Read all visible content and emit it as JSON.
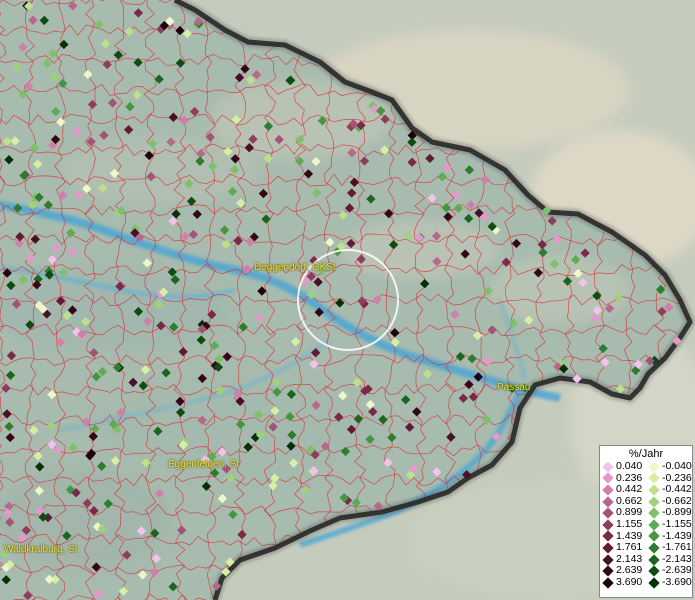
{
  "places": [
    {
      "id": "deggendorf",
      "label": "Deggendorf, GKSt"
    },
    {
      "id": "passau",
      "label": "Passau"
    },
    {
      "id": "eggenfelden",
      "label": "Eggenfelden, St"
    },
    {
      "id": "waldkraiburg",
      "label": "Waldkraiburg, St"
    }
  ],
  "legend": {
    "title": "%/Jahr",
    "positive": [
      "0.040",
      "0.236",
      "0.442",
      "0.662",
      "0.899",
      "1.155",
      "1.439",
      "1.761",
      "2.143",
      "2.639",
      "3.690"
    ],
    "negative": [
      "-0.040",
      "-0.236",
      "-0.442",
      "-0.662",
      "-0.899",
      "-1.155",
      "-1.439",
      "-1.761",
      "-2.143",
      "-2.639",
      "-3.690"
    ],
    "positive_colors": [
      "#f4c3ec",
      "#e39acb",
      "#cf7fa9",
      "#b8688d",
      "#a55276",
      "#8f3d5d",
      "#7a2a48",
      "#621a35",
      "#4a0e25",
      "#330716",
      "#1d020b"
    ],
    "negative_colors": [
      "#eef7c6",
      "#d7efa3",
      "#bde18a",
      "#9fd27c",
      "#7fc06a",
      "#5fab55",
      "#449640",
      "#2e7d2e",
      "#1c651d",
      "#0f4c10",
      "#053005"
    ]
  },
  "colors": {
    "land": "#a9bdb0",
    "river": "#4aa6d4",
    "boundary": "#e0202a",
    "border": "#111111",
    "outside": "#c9cfbf"
  }
}
